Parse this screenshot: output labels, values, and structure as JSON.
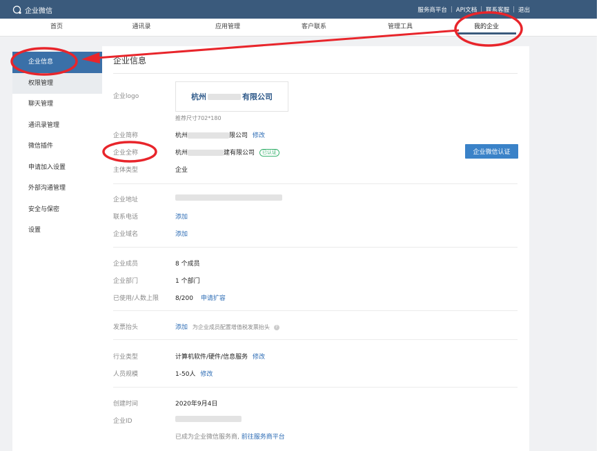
{
  "header": {
    "app_name": "企业微信",
    "links": [
      "服务商平台",
      "API文档",
      "联系客服",
      "退出"
    ]
  },
  "nav": {
    "tabs": [
      "首页",
      "通讯录",
      "应用管理",
      "客户联系",
      "管理工具",
      "我的企业"
    ],
    "active": "我的企业"
  },
  "sidebar": {
    "items": [
      "企业信息",
      "权限管理",
      "聊天管理",
      "通讯录管理",
      "微信插件",
      "申请加入设置",
      "外部沟通管理",
      "安全与保密",
      "设置"
    ]
  },
  "main": {
    "title": "企业信息",
    "logo": {
      "label": "企业logo",
      "text": "杭州",
      "text_end": "有限公司",
      "hint": "推荐尺寸702*180"
    },
    "short_name": {
      "label": "企业简称",
      "prefix": "杭州",
      "suffix": "限公司",
      "action": "修改"
    },
    "full_name": {
      "label": "企业全称",
      "prefix": "杭州",
      "suffix": "建有限公司",
      "badge": "已认证"
    },
    "type": {
      "label": "主体类型",
      "value": "企业"
    },
    "certify_button": "企业微信认证",
    "address": {
      "label": "企业地址"
    },
    "phone": {
      "label": "联系电话",
      "action": "添加"
    },
    "domain": {
      "label": "企业域名",
      "action": "添加"
    },
    "members": {
      "label": "企业成员",
      "value": "8 个成员"
    },
    "departments": {
      "label": "企业部门",
      "value": "1 个部门"
    },
    "limit": {
      "label": "已使用/人数上限",
      "value": "8/200",
      "action": "申请扩容"
    },
    "invoice": {
      "label": "发票抬头",
      "action": "添加",
      "note": "为企业成员配置增值税发票抬头"
    },
    "industry": {
      "label": "行业类型",
      "value": "计算机软件/硬件/信息服务",
      "action": "修改"
    },
    "scale": {
      "label": "人员规模",
      "value": "1-50人",
      "action": "修改"
    },
    "created": {
      "label": "创建时间",
      "value": "2020年9月4日"
    },
    "corp_id": {
      "label": "企业ID"
    },
    "provider_note": {
      "text": "已成为企业微信服务商,",
      "link": "前往服务商平台"
    }
  },
  "annotation_color": "#e8252b"
}
